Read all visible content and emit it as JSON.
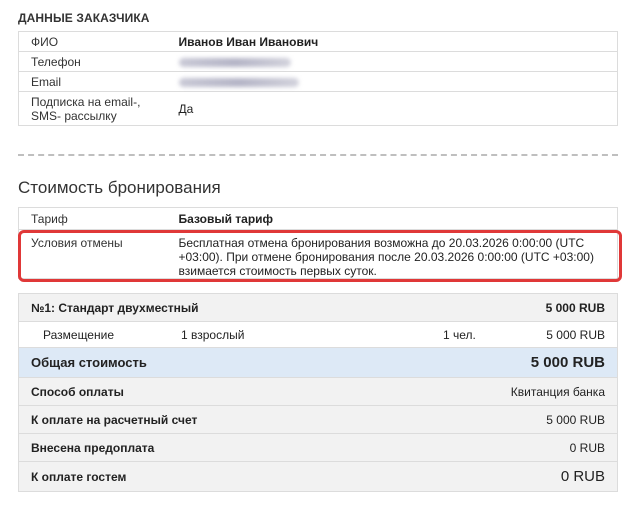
{
  "customer": {
    "heading": "ДАННЫЕ ЗАКАЗЧИКА",
    "rows": {
      "name": {
        "label": "ФИО",
        "value": "Иванов Иван Иванович"
      },
      "phone": {
        "label": "Телефон"
      },
      "email": {
        "label": "Email"
      },
      "subscription": {
        "label": "Подписка на email-, SMS- рассылку",
        "value": "Да"
      }
    }
  },
  "booking": {
    "title": "Стоимость бронирования",
    "tariff": {
      "label": "Тариф",
      "value": "Базовый тариф"
    },
    "cancellation": {
      "label": "Условия отмены",
      "value": "Бесплатная отмена бронирования возможна до 20.03.2026 0:00:00 (UTC +03:00). При отмене бронирования после 20.03.2026 0:00:00 (UTC +03:00) взимается стоимость первых суток."
    }
  },
  "cost": {
    "room": {
      "name": "№1: Стандарт двухместный",
      "price": "5 000 RUB"
    },
    "placement": {
      "label": "Размещение",
      "guests": "1 взрослый",
      "persons": "1 чел.",
      "price": "5 000 RUB"
    },
    "total": {
      "label": "Общая стоимость",
      "amount": "5 000 RUB"
    },
    "payment_method": {
      "label": "Способ оплаты",
      "value": "Квитанция банка"
    },
    "to_account": {
      "label": "К оплате на расчетный счет",
      "value": "5 000 RUB"
    },
    "prepaid": {
      "label": "Внесена предоплата",
      "value": "0 RUB"
    },
    "guest_pays": {
      "label": "К оплате гостем",
      "value": "0 RUB"
    }
  },
  "colors": {
    "highlight": "#e03838",
    "total_row": "#dde9f6",
    "grey_row": "#f2f2f2"
  }
}
